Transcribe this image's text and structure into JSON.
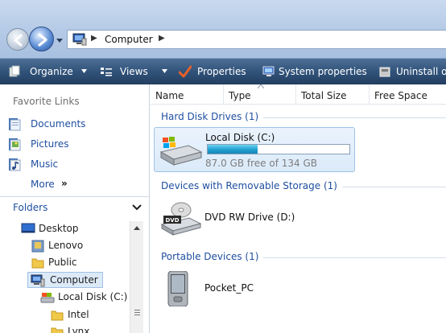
{
  "address": {
    "path": "Computer"
  },
  "toolbar": {
    "organize": "Organize",
    "views": "Views",
    "properties": "Properties",
    "system_properties": "System properties",
    "uninstall": "Uninstall o"
  },
  "favorites": {
    "title": "Favorite Links",
    "items": [
      {
        "label": "Documents",
        "icon": "documents-icon"
      },
      {
        "label": "Pictures",
        "icon": "pictures-icon"
      },
      {
        "label": "Music",
        "icon": "music-icon"
      }
    ],
    "more": "More",
    "more_arrows": "»"
  },
  "folders": {
    "title": "Folders",
    "tree": [
      {
        "label": "Desktop",
        "icon": "desktop-icon"
      },
      {
        "label": "Lenovo",
        "icon": "user-folder-icon"
      },
      {
        "label": "Public",
        "icon": "folder-icon"
      },
      {
        "label": "Computer",
        "icon": "computer-icon",
        "selected": true
      },
      {
        "label": "Local Disk (C:)",
        "icon": "drive-icon"
      },
      {
        "label": "Intel",
        "icon": "folder-icon"
      },
      {
        "label": "Lynx",
        "icon": "folder-icon"
      }
    ]
  },
  "columns": {
    "name": "Name",
    "type": "Type",
    "total_size": "Total Size",
    "free_space": "Free Space"
  },
  "groups": {
    "hard_disk": "Hard Disk Drives (1)",
    "removable": "Devices with Removable Storage (1)",
    "portable": "Portable Devices (1)"
  },
  "drives": {
    "local": {
      "name": "Local Disk (C:)",
      "free_text": "87.0 GB free of 134 GB",
      "used_fraction": 0.35
    },
    "dvd": {
      "name": "DVD RW Drive (D:)",
      "badge": "DVD"
    },
    "pocket": {
      "name": "Pocket_PC"
    }
  },
  "colors": {
    "link_blue": "#1f4fa0",
    "toolbar_dark": "#233e60",
    "selection": "#dce9f7"
  }
}
